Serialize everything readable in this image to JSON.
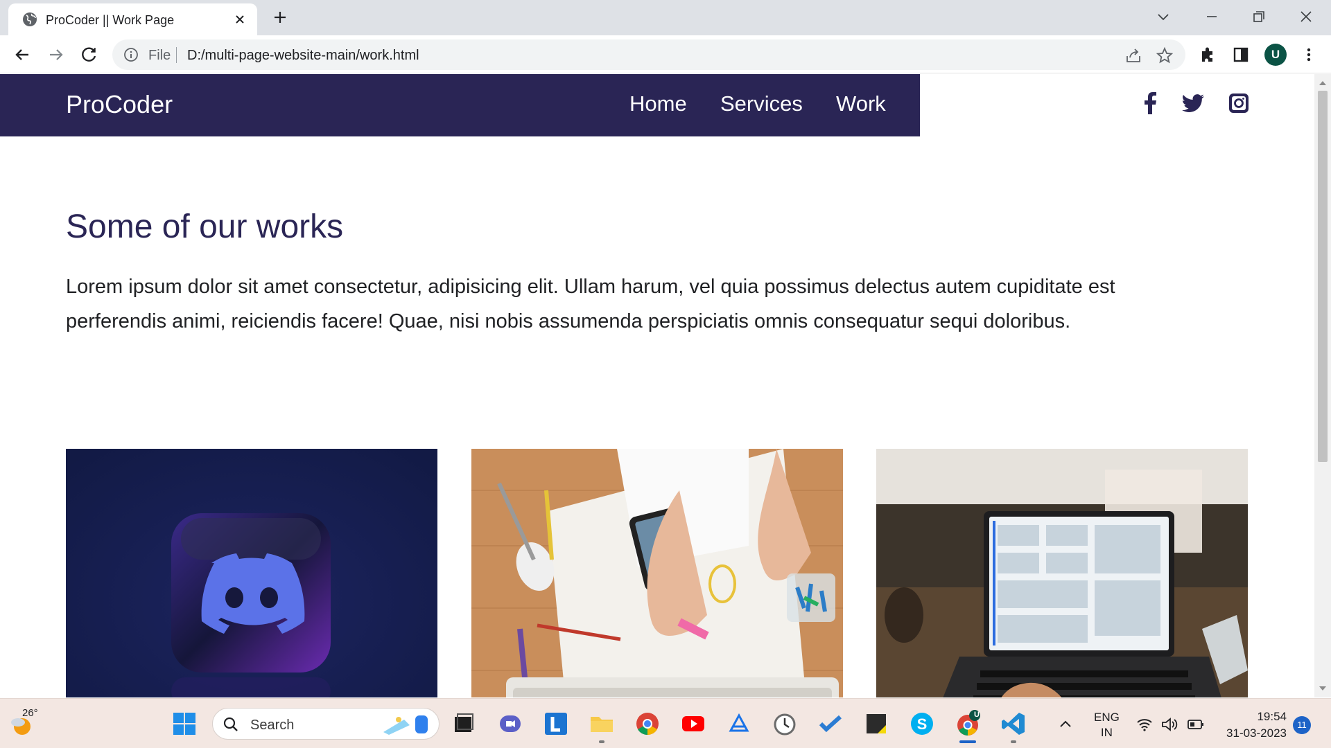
{
  "browser": {
    "tab_title": "ProCoder || Work Page",
    "file_label": "File",
    "url": "D:/multi-page-website-main/work.html",
    "profile_initial": "U"
  },
  "site": {
    "brand": "ProCoder",
    "nav": [
      {
        "label": "Home"
      },
      {
        "label": "Services"
      },
      {
        "label": "Work"
      }
    ],
    "social_icons": [
      "facebook-icon",
      "twitter-icon",
      "instagram-icon"
    ],
    "heading": "Some of our works",
    "paragraph": "Lorem ipsum dolor sit amet consectetur, adipisicing elit. Ullam harum, vel quia possimus delectus autem cupiditate est perferendis animi, reiciendis facere! Quae, nisi nobis assumenda perspiciatis omnis consequatur sequi doloribus.",
    "works": [
      {
        "image": "discord-logo-3d-image"
      },
      {
        "image": "desk-sketching-phone-image"
      },
      {
        "image": "laptop-dashboard-image"
      }
    ],
    "colors": {
      "nav_bg": "#2a2555",
      "heading": "#2a2555"
    }
  },
  "taskbar": {
    "weather_temp": "26°",
    "search_placeholder": "Search",
    "lang_line1": "ENG",
    "lang_line2": "IN",
    "time": "19:54",
    "date": "31-03-2023",
    "notification_count": "11",
    "chrome_badge": "U",
    "apps": [
      "file-manager-icon",
      "teams-meet-icon",
      "l-app-icon",
      "file-explorer-icon",
      "chrome-icon",
      "youtube-icon",
      "vector-app-icon",
      "clock-app-icon",
      "todo-icon",
      "sticky-notes-icon",
      "skype-icon",
      "chrome-active-icon",
      "vscode-icon"
    ]
  }
}
